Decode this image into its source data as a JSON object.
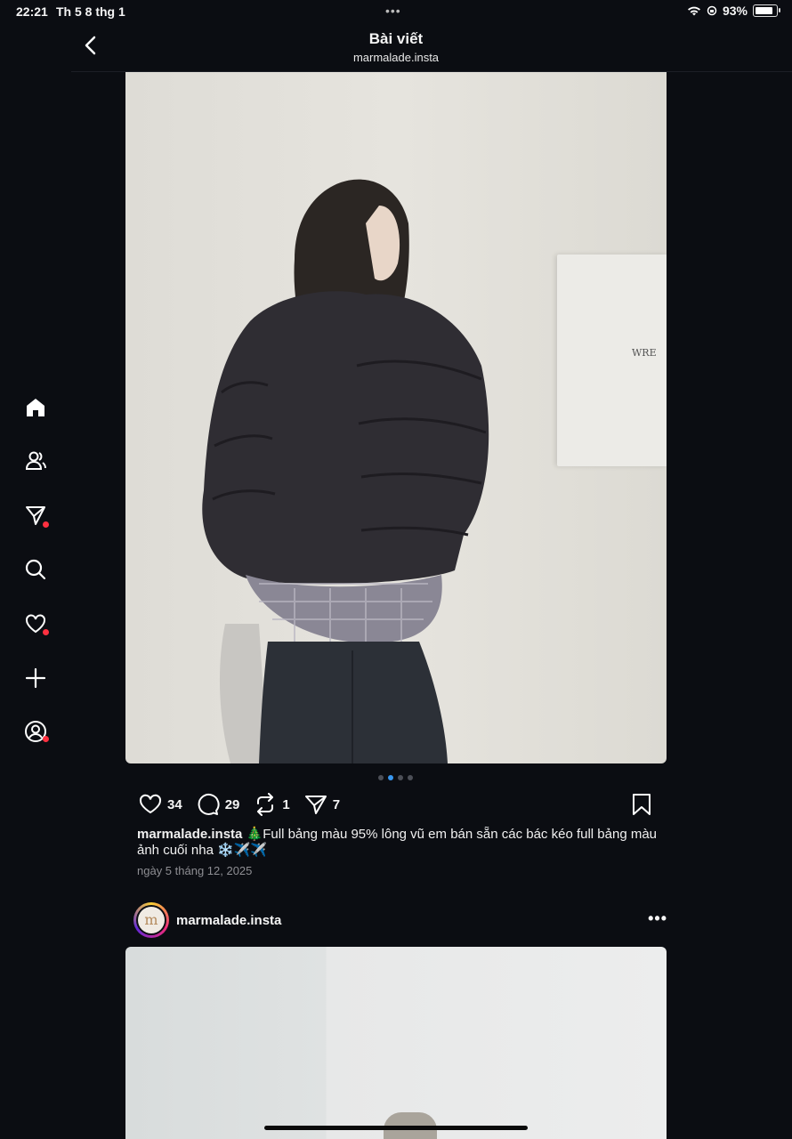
{
  "status_bar": {
    "time": "22:21",
    "date": "Th 5 8 thg 1",
    "battery": "93%"
  },
  "header": {
    "title": "Bài viết",
    "subtitle": "marmalade.insta"
  },
  "sidebar": {
    "items": [
      {
        "name": "home-icon"
      },
      {
        "name": "people-icon"
      },
      {
        "name": "send-icon"
      },
      {
        "name": "search-icon"
      },
      {
        "name": "heart-icon"
      },
      {
        "name": "plus-icon"
      },
      {
        "name": "profile-icon"
      }
    ]
  },
  "post": {
    "frame_logo": "WRE",
    "likes": "34",
    "comments": "29",
    "reposts": "1",
    "shares": "7",
    "caption_user": "marmalade.insta",
    "caption_text": "🎄Full bảng màu 95% lông vũ em bán sẵn các bác kéo full bảng màu ảnh cuối nha ❄️✈️✈️",
    "date": "ngày 5 tháng 12, 2025",
    "carousel_index": 2,
    "carousel_count": 4
  },
  "next_post": {
    "username": "marmalade.insta",
    "avatar_text": "m",
    "more": "•••"
  },
  "colors": {
    "background": "#0b0d12",
    "notification": "#ff3040",
    "active_dot": "#3897f0"
  }
}
